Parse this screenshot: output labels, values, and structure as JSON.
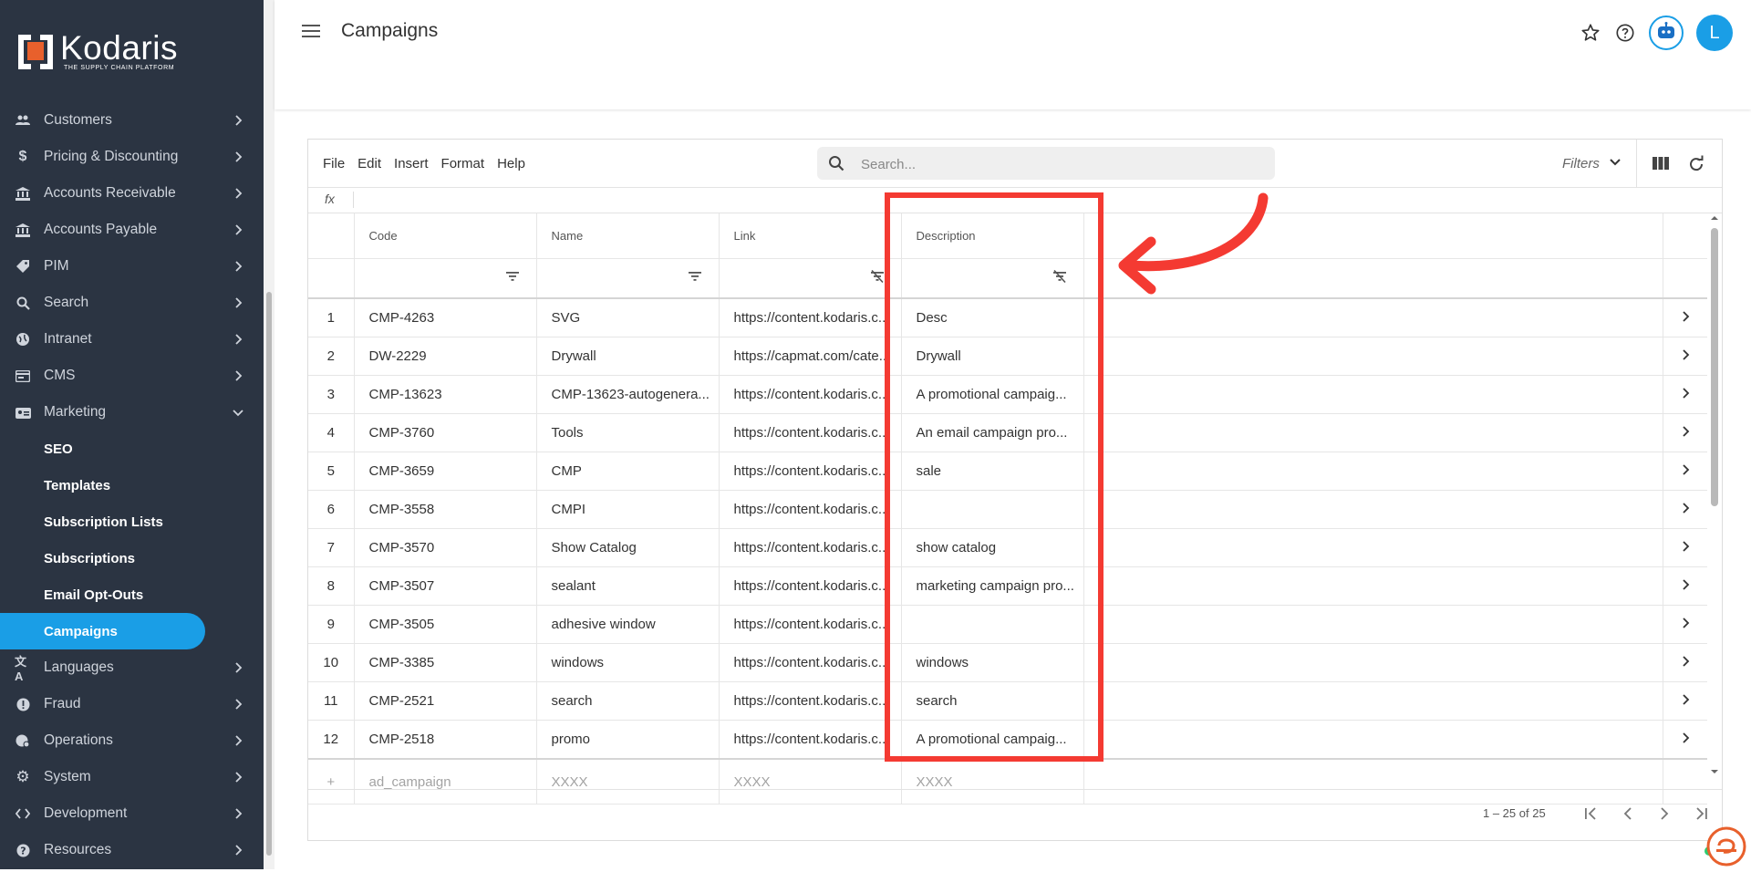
{
  "brand": {
    "name": "Kodaris",
    "tagline": "THE SUPPLY CHAIN PLATFORM",
    "accent": "#1a9ee6",
    "sidebar_bg": "#2b3442",
    "logo_orange": "#e8602c"
  },
  "sidebar": {
    "items": [
      {
        "label": "Customers",
        "icon": "users-icon"
      },
      {
        "label": "Pricing & Discounting",
        "icon": "dollar-icon"
      },
      {
        "label": "Accounts Receivable",
        "icon": "bank-icon"
      },
      {
        "label": "Accounts Payable",
        "icon": "bank-icon"
      },
      {
        "label": "PIM",
        "icon": "tag-icon"
      },
      {
        "label": "Search",
        "icon": "search-icon"
      },
      {
        "label": "Intranet",
        "icon": "globe-icon"
      },
      {
        "label": "CMS",
        "icon": "cms-icon"
      },
      {
        "label": "Marketing",
        "icon": "marketing-icon"
      }
    ],
    "marketing_sub": [
      {
        "label": "SEO"
      },
      {
        "label": "Templates"
      },
      {
        "label": "Subscription Lists"
      },
      {
        "label": "Subscriptions"
      },
      {
        "label": "Email Opt-Outs"
      },
      {
        "label": "Campaigns"
      }
    ],
    "items_after": [
      {
        "label": "Languages",
        "icon": "translate-icon"
      },
      {
        "label": "Fraud",
        "icon": "alert-icon"
      },
      {
        "label": "Operations",
        "icon": "operations-icon"
      },
      {
        "label": "System",
        "icon": "gear-icon"
      },
      {
        "label": "Development",
        "icon": "code-icon"
      },
      {
        "label": "Resources",
        "icon": "help-icon"
      }
    ]
  },
  "header": {
    "title": "Campaigns",
    "avatar_letter": "L"
  },
  "toolbar": {
    "menus": [
      "File",
      "Edit",
      "Insert",
      "Format",
      "Help"
    ],
    "search_placeholder": "Search...",
    "filters_label": "Filters"
  },
  "formula_bar": {
    "label": "fx"
  },
  "grid": {
    "columns": [
      "Code",
      "Name",
      "Link",
      "Description"
    ],
    "rows": [
      {
        "num": "1",
        "code": "CMP-4263",
        "name": "SVG",
        "link": "https://content.kodaris.c...",
        "desc": "Desc"
      },
      {
        "num": "2",
        "code": "DW-2229",
        "name": "Drywall",
        "link": "https://capmat.com/cate...",
        "desc": "Drywall"
      },
      {
        "num": "3",
        "code": "CMP-13623",
        "name": "CMP-13623-autogenera...",
        "link": "https://content.kodaris.c...",
        "desc": "A promotional campaig..."
      },
      {
        "num": "4",
        "code": "CMP-3760",
        "name": "Tools",
        "link": "https://content.kodaris.c...",
        "desc": "An email campaign pro..."
      },
      {
        "num": "5",
        "code": "CMP-3659",
        "name": "CMP",
        "link": "https://content.kodaris.c...",
        "desc": "sale"
      },
      {
        "num": "6",
        "code": "CMP-3558",
        "name": "CMPI",
        "link": "https://content.kodaris.c...",
        "desc": ""
      },
      {
        "num": "7",
        "code": "CMP-3570",
        "name": "Show Catalog",
        "link": "https://content.kodaris.c...",
        "desc": "show catalog"
      },
      {
        "num": "8",
        "code": "CMP-3507",
        "name": "sealant",
        "link": "https://content.kodaris.c...",
        "desc": "marketing campaign pro..."
      },
      {
        "num": "9",
        "code": "CMP-3505",
        "name": "adhesive window",
        "link": "https://content.kodaris.c...",
        "desc": ""
      },
      {
        "num": "10",
        "code": "CMP-3385",
        "name": "windows",
        "link": "https://content.kodaris.c...",
        "desc": "windows"
      },
      {
        "num": "11",
        "code": "CMP-2521",
        "name": "search",
        "link": "https://content.kodaris.c...",
        "desc": "search"
      },
      {
        "num": "12",
        "code": "CMP-2518",
        "name": "promo",
        "link": "https://content.kodaris.c...",
        "desc": "A promotional campaig..."
      }
    ],
    "new_row": {
      "code": "ad_campaign",
      "name": "XXXX",
      "link": "XXXX",
      "desc": "XXXX"
    }
  },
  "pagination": {
    "range": "1 – 25 of 25"
  },
  "annotation": {
    "color": "#f43a32"
  }
}
